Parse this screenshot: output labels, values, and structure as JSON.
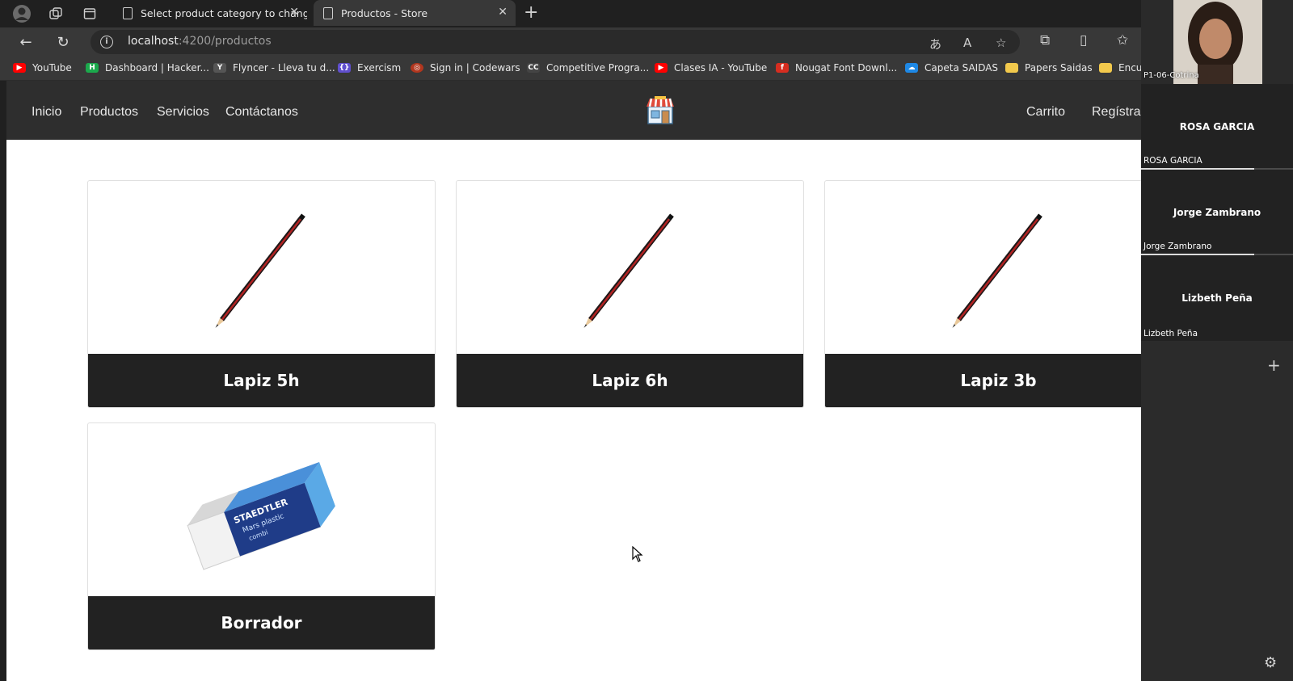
{
  "browser": {
    "tabs": [
      {
        "title": "Select product category to chang",
        "active": false
      },
      {
        "title": "Productos - Store",
        "active": true
      }
    ],
    "address": {
      "host": "localhost",
      "path": ":4200/productos"
    },
    "bookmarks": [
      {
        "label": "YouTube",
        "color": "#ff0000",
        "glyph": "▶"
      },
      {
        "label": "Dashboard | Hacker...",
        "color": "#1ba94c",
        "glyph": "H"
      },
      {
        "label": "Flyncer - Lleva tu d...",
        "color": "#555555",
        "glyph": "Y"
      },
      {
        "label": "Exercism",
        "color": "#604fcd",
        "glyph": "{}"
      },
      {
        "label": "Sign in | Codewars",
        "color": "#b1361e",
        "glyph": "◎"
      },
      {
        "label": "Competitive Progra...",
        "color": "#444444",
        "glyph": "CC"
      },
      {
        "label": "Clases IA - YouTube",
        "color": "#ff0000",
        "glyph": "▶"
      },
      {
        "label": "Nougat Font Downl...",
        "color": "#d62d20",
        "glyph": "f"
      },
      {
        "label": "Capeta SAIDAS",
        "color": "#1e88e5",
        "glyph": "☁"
      },
      {
        "label": "Papers Saidas",
        "color": "#f2c94c",
        "glyph": ""
      },
      {
        "label": "Encu",
        "color": "#f2c94c",
        "glyph": ""
      }
    ]
  },
  "site": {
    "nav_left": [
      "Inicio",
      "Productos",
      "Servicios",
      "Contáctanos"
    ],
    "nav_right": [
      "Carrito",
      "Regístra"
    ]
  },
  "products": [
    {
      "name": "Lapiz 5h",
      "image": "pencil"
    },
    {
      "name": "Lapiz 6h",
      "image": "pencil"
    },
    {
      "name": "Lapiz 3b",
      "image": "pencil"
    },
    {
      "name": "Borrador",
      "image": "eraser"
    }
  ],
  "eraser_text": {
    "brand": "STAEDTLER",
    "line1": "Mars plastic",
    "line2": "combi"
  },
  "meeting": {
    "self_label": "P1-06-Cotrina",
    "participants": [
      {
        "name": "ROSA GARCIA",
        "label": "ROSA GARCIA"
      },
      {
        "name": "Jorge Zambrano",
        "label": "Jorge Zambrano"
      },
      {
        "name": "Lizbeth Peña",
        "label": "Lizbeth Peña"
      }
    ]
  }
}
